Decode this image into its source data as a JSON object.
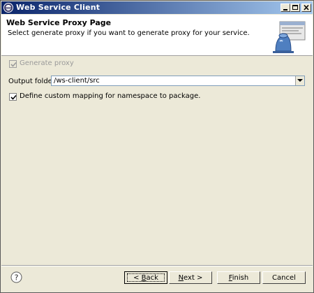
{
  "window": {
    "title": "Web Service Client",
    "controls": {
      "minimize_icon": "minimize-icon",
      "maximize_icon": "maximize-icon",
      "close_icon": "close-icon"
    }
  },
  "header": {
    "title": "Web Service Proxy Page",
    "description": "Select generate proxy if you want to generate proxy for your service.",
    "banner_icon": "wizard-banner-icon"
  },
  "form": {
    "generate_proxy": {
      "label": "Generate proxy",
      "checked": true,
      "enabled": false
    },
    "output_folder": {
      "label": "Output folder",
      "value": "/ws-client/src"
    },
    "custom_mapping": {
      "label": "Define custom mapping for namespace to package.",
      "checked": true,
      "enabled": true
    }
  },
  "footer": {
    "help_icon": "help-icon",
    "back": {
      "pre": "< ",
      "mnemonic": "B",
      "post": "ack"
    },
    "next": {
      "pre": "",
      "mnemonic": "N",
      "post": "ext >"
    },
    "finish": {
      "pre": "",
      "mnemonic": "F",
      "post": "inish"
    },
    "cancel": {
      "label": "Cancel"
    }
  },
  "colors": {
    "titlebar_start": "#0a246a",
    "titlebar_end": "#a6caf0",
    "dialog_bg": "#ece9d8",
    "disabled_text": "#9a9a9a"
  }
}
